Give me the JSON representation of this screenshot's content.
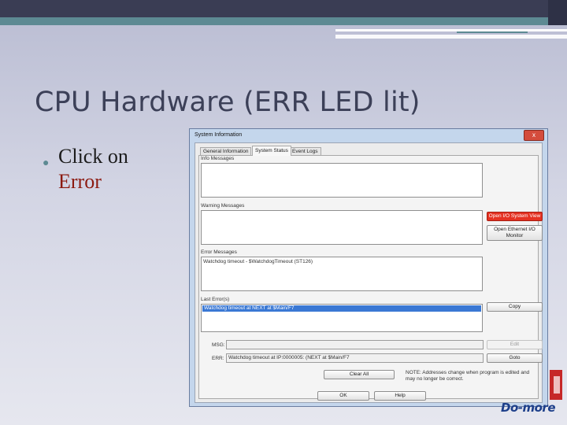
{
  "slide": {
    "title": "CPU Hardware (ERR LED lit)",
    "bullet_line1": "Click on",
    "bullet_line2": "Error"
  },
  "dialog": {
    "title": "System Information",
    "close_glyph": "x",
    "tabs": [
      "General Information",
      "System Status",
      "Event Logs"
    ],
    "active_tab": "System Status",
    "info_label": "Info Messages",
    "warning_label": "Warning Messages",
    "error_label": "Error Messages",
    "error_text": "Watchdog timeout - $WatchdogTimeout (ST126)",
    "last_error_label": "Last Error(s)",
    "last_error_row": "Watchdog timeout at NEXT at $Main/F7",
    "open_io_button": "Open I/O System View",
    "open_ethernet_button": "Open Ethernet I/O Monitor",
    "copy_button": "Copy",
    "msg_label": "MSG:",
    "err_label": "ERR:",
    "err_field": "Watchdog timeout at IP:0000005: (NEXT at $Main/F7",
    "edit_button": "Edit",
    "goto_button": "Goto",
    "clear_all_button": "Clear All",
    "note": "NOTE: Addresses change when program is edited and may no longer be correct.",
    "ok_button": "OK",
    "help_button": "Help"
  },
  "brand": "Do-more"
}
